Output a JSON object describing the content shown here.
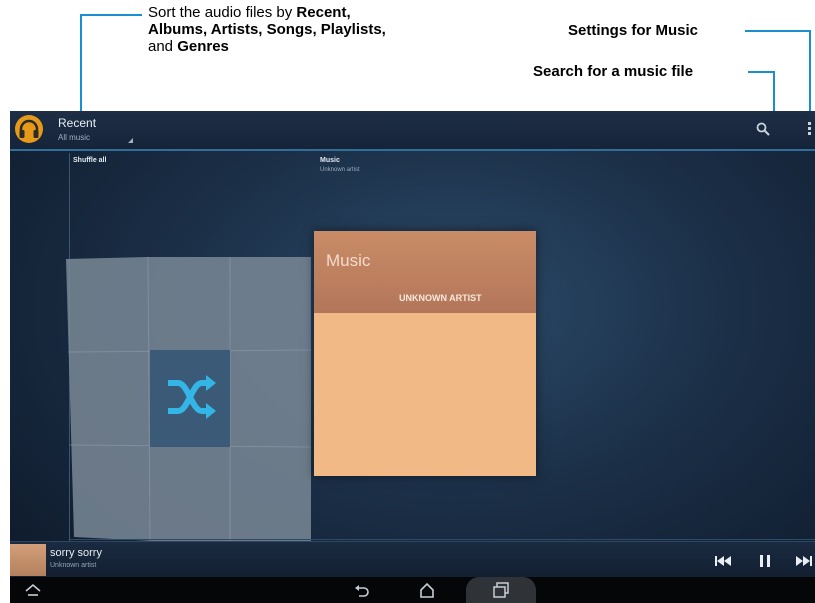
{
  "callouts": {
    "sort": {
      "line1_pre": "Sort the audio files by ",
      "line1_bold": "Recent,",
      "line2": "Albums, Artists, Songs, Playlists,",
      "line3_pre": "and ",
      "line3_bold": "Genres"
    },
    "settings": "Settings for Music",
    "search": "Search for a music file"
  },
  "actionbar": {
    "title": "Recent",
    "subtitle": "All music",
    "icons": [
      "headphones-icon",
      "search-icon",
      "overflow-menu-icon"
    ]
  },
  "columns": {
    "left_title": "Shuffle all",
    "right_title": "Music",
    "right_subtitle": "Unknown artist"
  },
  "album_card": {
    "title": "Music",
    "artist": "UNKNOWN ARTIST"
  },
  "now_playing": {
    "title": "sorry sorry",
    "artist": "Unknown artist",
    "controls": [
      "previous-icon",
      "pause-icon",
      "next-icon"
    ]
  },
  "navbar": {
    "icons": [
      "hide-keyboard-icon",
      "back-icon",
      "home-icon",
      "recent-apps-icon"
    ]
  },
  "colors": {
    "accent": "#1a8fd0",
    "album": "#f0b985",
    "album_header": "#b4765a"
  }
}
